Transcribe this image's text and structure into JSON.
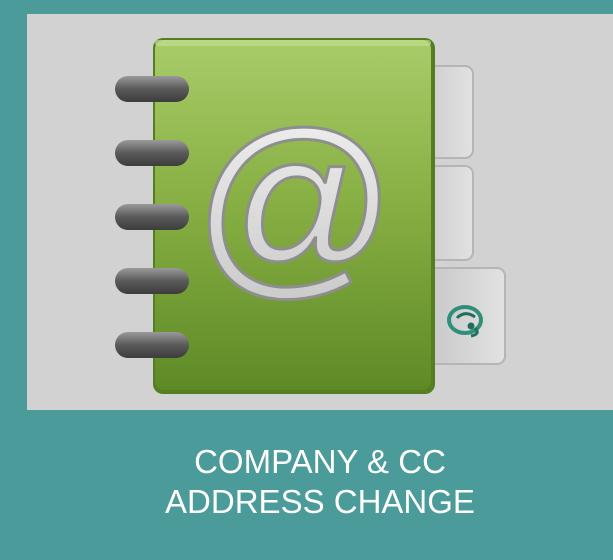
{
  "tile": {
    "caption_line1": "COMPANY & CC",
    "caption_line2": "ADDRESS CHANGE",
    "icon": "address-book-at-icon",
    "colors": {
      "tile_background": "#4b9b9a",
      "icon_background": "#d2d2d2",
      "book_green": "#7fa83a",
      "caption_text": "#ffffff"
    }
  }
}
